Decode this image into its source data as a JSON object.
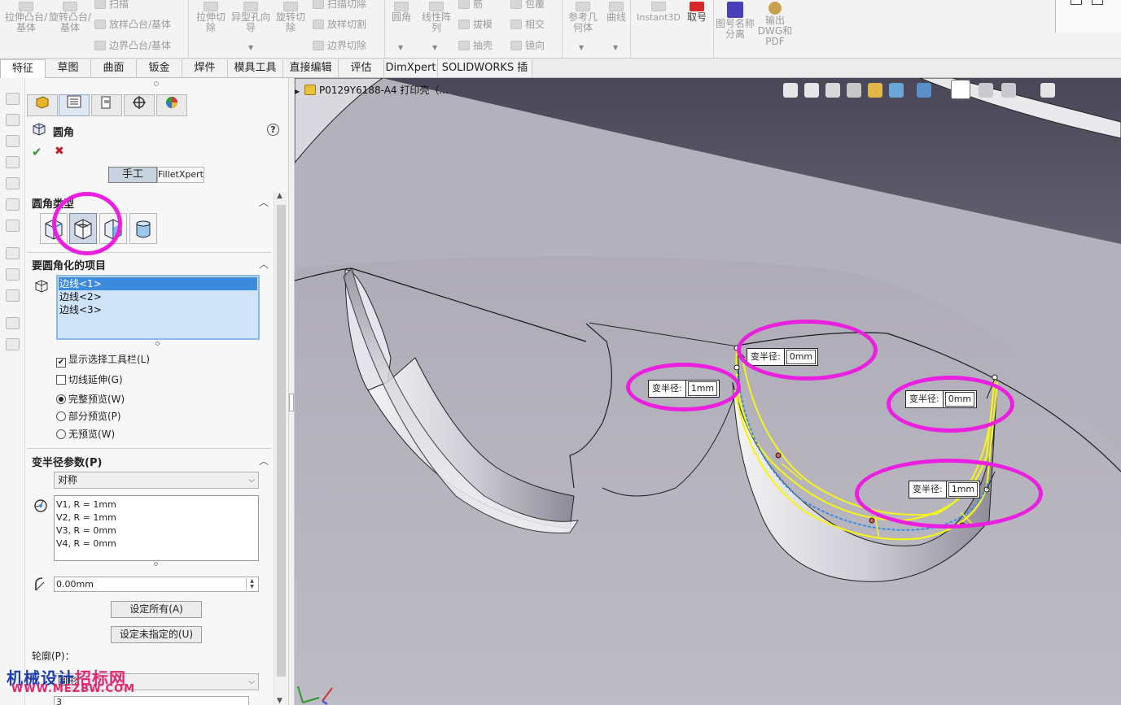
{
  "ribbon": {
    "groups": [
      {
        "items": [
          {
            "label": "拉伸凸台/基体",
            "icon": "extrude-boss-icon"
          },
          {
            "label": "旋转凸台/基体",
            "icon": "revolve-boss-icon"
          },
          {
            "label": "扫描",
            "icon": "sweep-icon"
          },
          {
            "label": "放样凸台/基体",
            "icon": "loft-boss-icon"
          },
          {
            "label": "边界凸台/基体",
            "icon": "boundary-boss-icon"
          }
        ]
      },
      {
        "items": [
          {
            "label": "拉伸切除",
            "icon": "extrude-cut-icon"
          },
          {
            "label": "异型孔向导",
            "icon": "hole-wizard-icon"
          },
          {
            "label": "旋转切除",
            "icon": "revolve-cut-icon"
          },
          {
            "label": "扫描切除",
            "icon": "sweep-cut-icon"
          },
          {
            "label": "放样切割",
            "icon": "loft-cut-icon"
          },
          {
            "label": "边界切除",
            "icon": "boundary-cut-icon"
          }
        ]
      },
      {
        "items": [
          {
            "label": "圆角",
            "icon": "fillet-icon"
          },
          {
            "label": "线性阵列",
            "icon": "linear-pattern-icon"
          },
          {
            "label": "筋",
            "icon": "rib-icon"
          },
          {
            "label": "拔模",
            "icon": "draft-icon"
          },
          {
            "label": "抽壳",
            "icon": "shell-icon"
          },
          {
            "label": "包覆",
            "icon": "wrap-icon"
          },
          {
            "label": "相交",
            "icon": "intersect-icon"
          },
          {
            "label": "镜向",
            "icon": "mirror-icon"
          }
        ]
      },
      {
        "items": [
          {
            "label": "参考几何体",
            "icon": "reference-geometry-icon"
          },
          {
            "label": "曲线",
            "icon": "curves-icon"
          }
        ]
      },
      {
        "items": [
          {
            "label": "Instant3D",
            "icon": "instant3d-icon"
          },
          {
            "label": "取号",
            "icon": "number-icon"
          }
        ]
      },
      {
        "items": [
          {
            "label": "图号名称分离",
            "icon": "split-name-icon"
          },
          {
            "label": "输出DWG和PDF",
            "icon": "export-dwg-icon"
          }
        ]
      }
    ]
  },
  "tabs": [
    "特征",
    "草图",
    "曲面",
    "钣金",
    "焊件",
    "模具工具",
    "直接编辑",
    "评估",
    "DimXpert",
    "SOLIDWORKS 插件"
  ],
  "active_tab": "特征",
  "pm": {
    "title": "圆角",
    "help": "?",
    "ok": "✔",
    "cancel": "✖",
    "mode_manual": "手工",
    "mode_fx": "FilletXpert",
    "fillet_type_header": "圆角类型",
    "items_header": "要圆角化的项目",
    "items": [
      "边线<1>",
      "边线<2>",
      "边线<3>"
    ],
    "show_toolbar": "显示选择工具栏(L)",
    "tangent_prop": "切线延伸(G)",
    "preview_full": "完整预览(W)",
    "preview_partial": "部分预览(P)",
    "preview_none": "无预览(W)",
    "var_header": "变半径参数(P)",
    "symmetric": "对称",
    "var_list": [
      "V1, R = 1mm",
      "V2, R = 1mm",
      "V3, R = 0mm",
      "V4, R = 0mm"
    ],
    "radius_value": "0.00mm",
    "set_all": "设定所有(A)",
    "set_unassigned": "设定未指定的(U)",
    "profile_label": "轮廓(P)：",
    "profile_value": "圆形",
    "count_value": "3"
  },
  "viewport": {
    "tree_node": "P0129Y6188-A4 打印壳（...",
    "callout_label": "变半径:",
    "callouts": [
      "1mm",
      "0mm",
      "0mm",
      "1mm"
    ],
    "background": "#b1afb8",
    "highlight_color": "#ea1fe0",
    "edge_color": "#f4f41a",
    "selected_edge_color": "#3a8fe0"
  },
  "watermark": {
    "name_part1": "机械设计",
    "name_part2": "招标网",
    "url": "WWW.MEZBW.COM"
  }
}
